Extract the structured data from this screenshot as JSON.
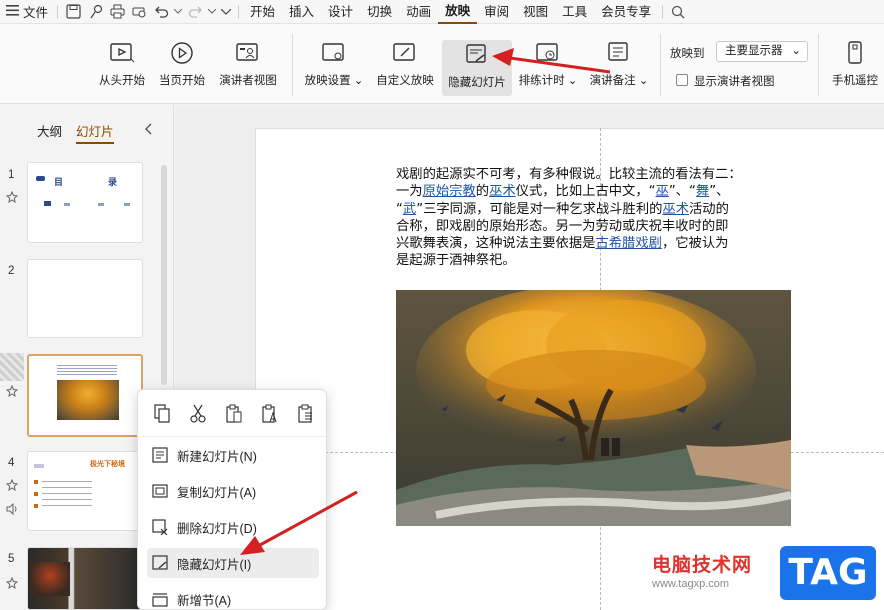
{
  "menu": {
    "file": "文件",
    "tabs": [
      "开始",
      "插入",
      "设计",
      "切换",
      "动画",
      "放映",
      "审阅",
      "视图",
      "工具",
      "会员专享"
    ],
    "active_tab": "放映"
  },
  "ribbon": {
    "from_start": "从头开始",
    "from_current": "当页开始",
    "presenter_view": "演讲者视图",
    "show_settings": "放映设置",
    "custom_show": "自定义放映",
    "hide_slide": "隐藏幻灯片",
    "rehearse": "排练计时",
    "speaker_notes": "演讲备注",
    "show_to_label": "放映到",
    "monitor_value": "主要显示器",
    "show_presenter_label": "显示演讲者视图",
    "phone_remote": "手机遥控"
  },
  "left_panel": {
    "tab_outline": "大纲",
    "tab_slides": "幻灯片",
    "slide_numbers": [
      "1",
      "2",
      "3",
      "4",
      "5"
    ],
    "slide1_title_a": "目",
    "slide1_title_b": "录",
    "slide4_title": "极光下秘境"
  },
  "slide": {
    "text_lines": [
      {
        "parts": [
          {
            "t": "戏剧的起源实不可考，有多种假说。比较主流的看法有二："
          }
        ]
      },
      {
        "parts": [
          {
            "t": "一为"
          },
          {
            "t": "原始宗教",
            "link": true
          },
          {
            "t": "的"
          },
          {
            "t": "巫术",
            "link": true
          },
          {
            "t": "仪式，比如上古中文，“"
          },
          {
            "t": "巫",
            "link": true
          },
          {
            "t": "”、“"
          },
          {
            "t": "舞",
            "link": true
          },
          {
            "t": "”、"
          }
        ]
      },
      {
        "parts": [
          {
            "t": "“"
          },
          {
            "t": "武",
            "link": true
          },
          {
            "t": "”三字同源，可能是对一种乞求战斗胜利的"
          },
          {
            "t": "巫术",
            "link": true
          },
          {
            "t": "活动的"
          }
        ]
      },
      {
        "parts": [
          {
            "t": "合称，即戏剧的原始形态。另一为劳动或庆祝丰收时的即"
          }
        ]
      },
      {
        "parts": [
          {
            "t": "兴歌舞表演，这种说法主要依据是"
          },
          {
            "t": "古希腊戏剧",
            "link": true
          },
          {
            "t": "，它被认为"
          }
        ]
      },
      {
        "parts": [
          {
            "t": "是起源于酒神祭祀。"
          }
        ]
      }
    ]
  },
  "context_menu": {
    "new_slide": "新建幻灯片(N)",
    "duplicate_slide": "复制幻灯片(A)",
    "delete_slide": "删除幻灯片(D)",
    "hide_slide": "隐藏幻灯片(I)",
    "new_section": "新增节(A)"
  },
  "watermark": {
    "site_name": "电脑技术网",
    "url": "www.tagxp.com",
    "tag": "TAG"
  },
  "colors": {
    "accent": "#8a4a00",
    "link": "#1f55a3",
    "arrow": "#d42020"
  }
}
